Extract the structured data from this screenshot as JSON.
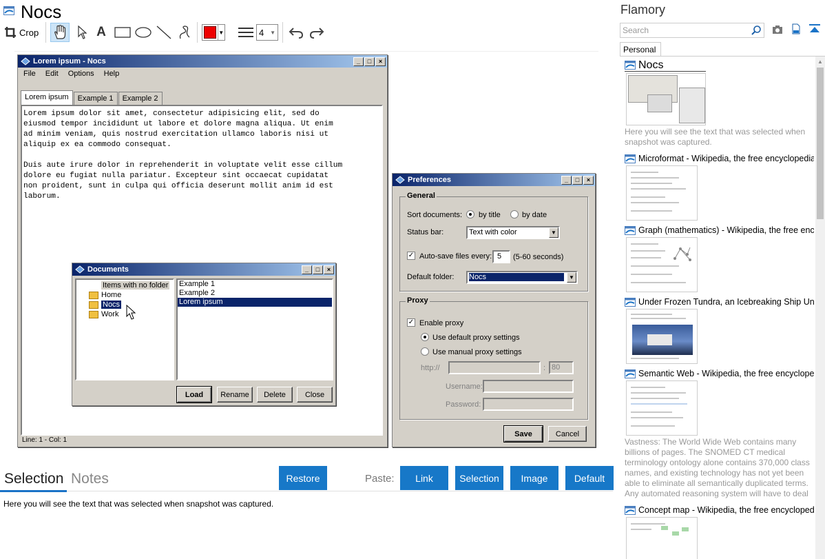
{
  "app": {
    "title": "Nocs",
    "brand": "Flamory"
  },
  "toolbar": {
    "crop_label": "Crop",
    "line_width": "4",
    "color": "#ee0000"
  },
  "main_window": {
    "title": "Lorem ipsum - Nocs",
    "menu": [
      "File",
      "Edit",
      "Options",
      "Help"
    ],
    "tabs": [
      "Lorem ipsum",
      "Example 1",
      "Example 2"
    ],
    "paragraphs": [
      "Lorem ipsum dolor sit amet, consectetur adipisicing elit, sed do\neiusmod tempor incididunt ut labore et dolore magna aliqua. Ut enim\nad minim veniam, quis nostrud exercitation ullamco laboris nisi ut\naliquip ex ea commodo consequat.",
      "Duis aute irure dolor in reprehenderit in voluptate velit esse cillum\ndolore eu fugiat nulla pariatur. Excepteur sint occaecat cupidatat\nnon proident, sunt in culpa qui officia deserunt mollit anim id est\nlaborum."
    ],
    "status": "Line: 1 - Col: 1"
  },
  "documents_window": {
    "title": "Documents",
    "tree": [
      "Items with no folder",
      "Home",
      "Nocs",
      "Work"
    ],
    "files": [
      "Example 1",
      "Example 2",
      "Lorem ipsum"
    ],
    "buttons": [
      "Load",
      "Rename",
      "Delete",
      "Close"
    ]
  },
  "preferences_window": {
    "title": "Preferences",
    "general": {
      "title": "General",
      "sort_label": "Sort documents:",
      "sort_title": "by title",
      "sort_date": "by date",
      "status_label": "Status bar:",
      "status_value": "Text with color",
      "autosave_label": "Auto-save files every:",
      "autosave_value": "5",
      "autosave_hint": "(5-60 seconds)",
      "folder_label": "Default folder:",
      "folder_value": "Nocs"
    },
    "proxy": {
      "title": "Proxy",
      "enable": "Enable proxy",
      "default": "Use default proxy settings",
      "manual": "Use manual proxy settings",
      "http": "http://",
      "colon": ":",
      "port": "80",
      "username": "Username:",
      "password": "Password:"
    },
    "save": "Save",
    "cancel": "Cancel"
  },
  "bottom": {
    "tab_selection": "Selection",
    "tab_notes": "Notes",
    "restore": "Restore",
    "paste_label": "Paste:",
    "paste_link": "Link",
    "paste_selection": "Selection",
    "paste_image": "Image",
    "paste_default": "Default",
    "selection_text": "Here you will see the text that was selected when snapshot was captured."
  },
  "sidebar": {
    "search_placeholder": "Search",
    "tab": "Personal",
    "entries": [
      {
        "title": "Nocs",
        "desc": "Here you will see the text that was selected when snapshot was captured."
      },
      {
        "title": "Microformat - Wikipedia, the free encyclopedia",
        "desc": ""
      },
      {
        "title": "Graph (mathematics) - Wikipedia, the free ency",
        "desc": ""
      },
      {
        "title": "Under Frozen Tundra, an Icebreaking Ship Unco",
        "desc": ""
      },
      {
        "title": "Semantic Web - Wikipedia, the free encycloped",
        "desc": "Vastness: The World Wide Web contains many billions of pages. The SNOMED CT medical terminology ontology alone contains 370,000 class names, and existing technology has not yet been able to eliminate all semantically duplicated terms. Any automated reasoning system will have to deal with truly huge inputs."
      },
      {
        "title": "Concept map - Wikipedia, the free encyclopedi",
        "desc": ""
      }
    ]
  }
}
